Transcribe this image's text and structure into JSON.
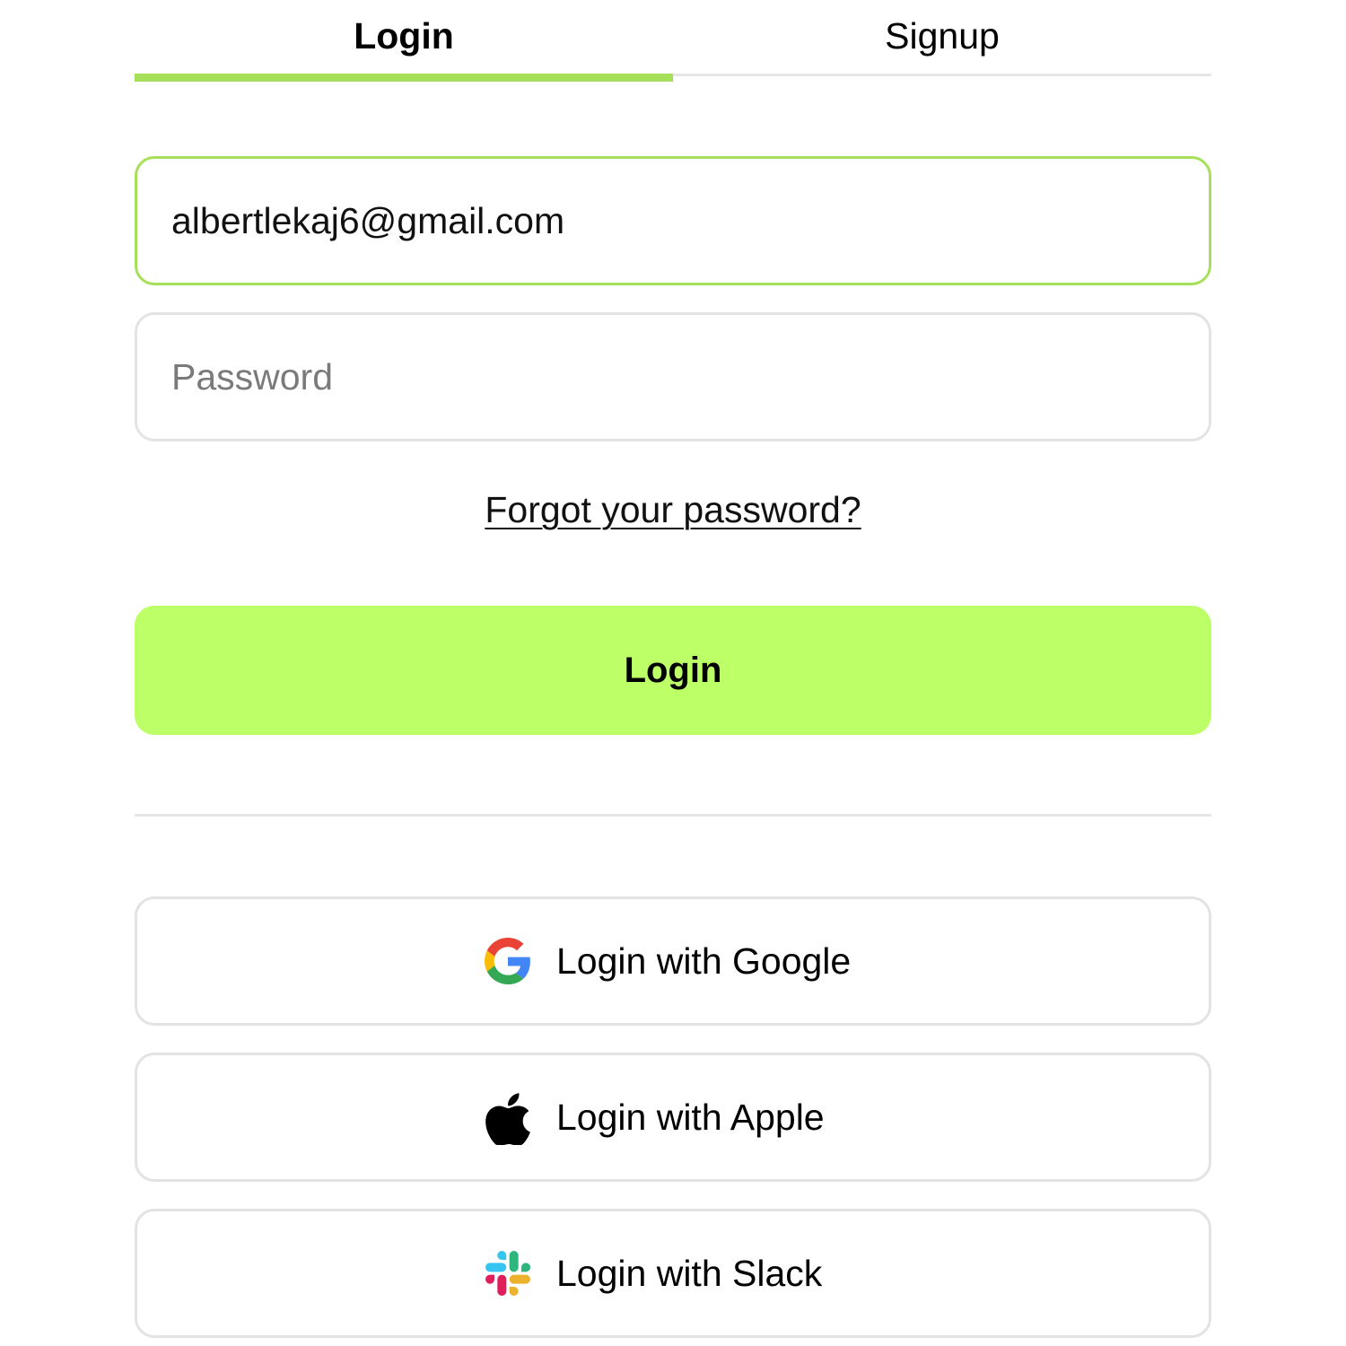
{
  "tabs": {
    "login_label": "Login",
    "signup_label": "Signup",
    "active": "login"
  },
  "form": {
    "email_value": "albertlekaj6@gmail.com",
    "password_value": "",
    "password_placeholder": "Password",
    "forgot_label": "Forgot your password?",
    "submit_label": "Login"
  },
  "social": {
    "google": {
      "label": "Login with Google",
      "icon": "google-icon"
    },
    "apple": {
      "label": "Login with Apple",
      "icon": "apple-icon"
    },
    "slack": {
      "label": "Login with Slack",
      "icon": "slack-icon"
    }
  },
  "colors": {
    "accent": "#bdff66",
    "accent_border": "#a6e05b",
    "field_border": "#e3e3e3",
    "divider": "#e6e6e6"
  }
}
